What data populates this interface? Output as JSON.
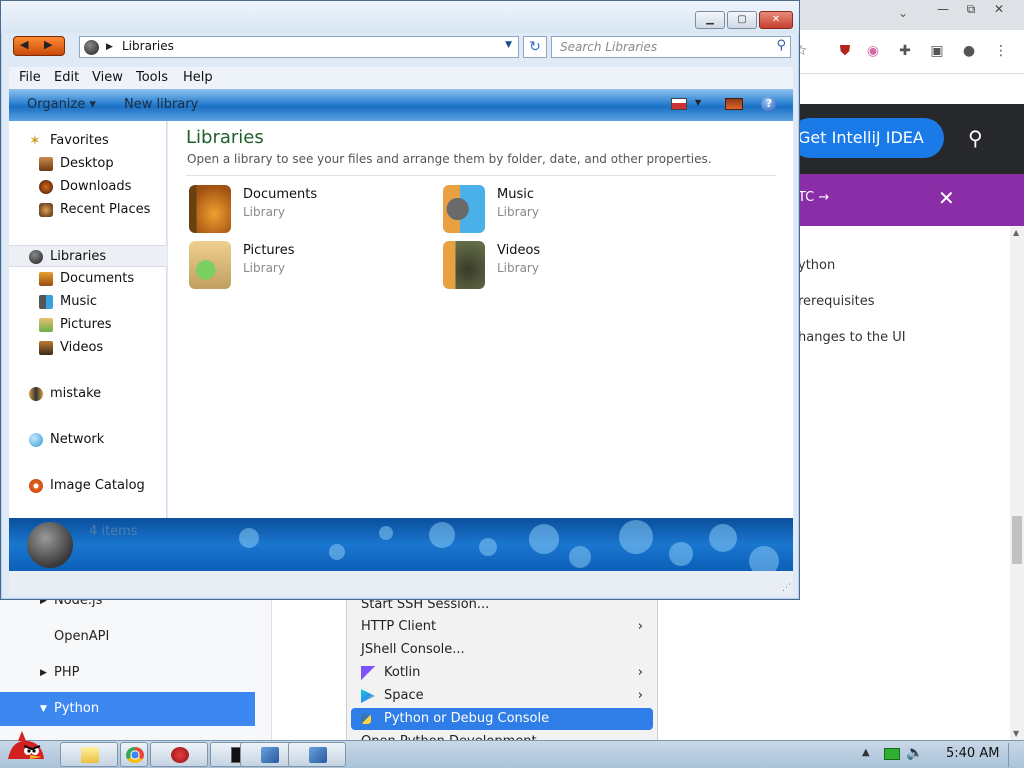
{
  "browser": {
    "window_controls": {
      "minimize": "—",
      "maximize": "⧉",
      "close": "✕"
    },
    "tab_dropdown": "⌄",
    "cta_button": "Get IntelliJ IDEA",
    "banner_text": "TC  →",
    "banner_close": "✕",
    "toc": [
      "ython",
      "rerequisites",
      "hanges to the UI"
    ]
  },
  "ide_tree": [
    {
      "label": "Node.js",
      "arrow": "▶",
      "selected": false
    },
    {
      "label": "OpenAPI",
      "arrow": "",
      "selected": false
    },
    {
      "label": "PHP",
      "arrow": "▶",
      "selected": false
    },
    {
      "label": "Python",
      "arrow": "▼",
      "selected": true
    }
  ],
  "context_menu": [
    {
      "label": "Start SSH Session...",
      "icon": "",
      "submenu": false,
      "highlighted": false
    },
    {
      "label": "HTTP Client",
      "icon": "",
      "submenu": true,
      "highlighted": false
    },
    {
      "label": "JShell Console...",
      "icon": "",
      "submenu": false,
      "highlighted": false
    },
    {
      "label": "Kotlin",
      "icon": "kotlin-icon",
      "submenu": true,
      "highlighted": false
    },
    {
      "label": "Space",
      "icon": "space-icon",
      "submenu": true,
      "highlighted": false
    },
    {
      "label": "Python or Debug Console",
      "icon": "python-icon",
      "submenu": false,
      "highlighted": true
    },
    {
      "label": "Open Python Development...",
      "icon": "",
      "submenu": false,
      "highlighted": false
    }
  ],
  "explorer": {
    "address": "Libraries",
    "search_placeholder": "Search Libraries",
    "menu": [
      "File",
      "Edit",
      "View",
      "Tools",
      "Help"
    ],
    "commands": {
      "organize": "Organize ▾",
      "new_library": "New library"
    },
    "nav": {
      "favorites": "Favorites",
      "desktop": "Desktop",
      "downloads": "Downloads",
      "recent": "Recent Places",
      "libraries": "Libraries",
      "lib_documents": "Documents",
      "lib_music": "Music",
      "lib_pictures": "Pictures",
      "lib_videos": "Videos",
      "mistake": "mistake",
      "network": "Network",
      "image_catalog": "Image Catalog"
    },
    "title": "Libraries",
    "subtitle": "Open a library to see your files and arrange them by folder, date, and other properties.",
    "libraries": [
      {
        "name": "Documents",
        "type": "Library"
      },
      {
        "name": "Music",
        "type": "Library"
      },
      {
        "name": "Pictures",
        "type": "Library"
      },
      {
        "name": "Videos",
        "type": "Library"
      }
    ],
    "item_count": "4 items"
  },
  "taskbar": {
    "time": "5:40 AM"
  },
  "colors": {
    "accent": "#3d88f0",
    "menu_highlight": "#2f7de6",
    "intellij_blue": "#1a7ae8",
    "banner_purple": "#8a2ea8"
  }
}
